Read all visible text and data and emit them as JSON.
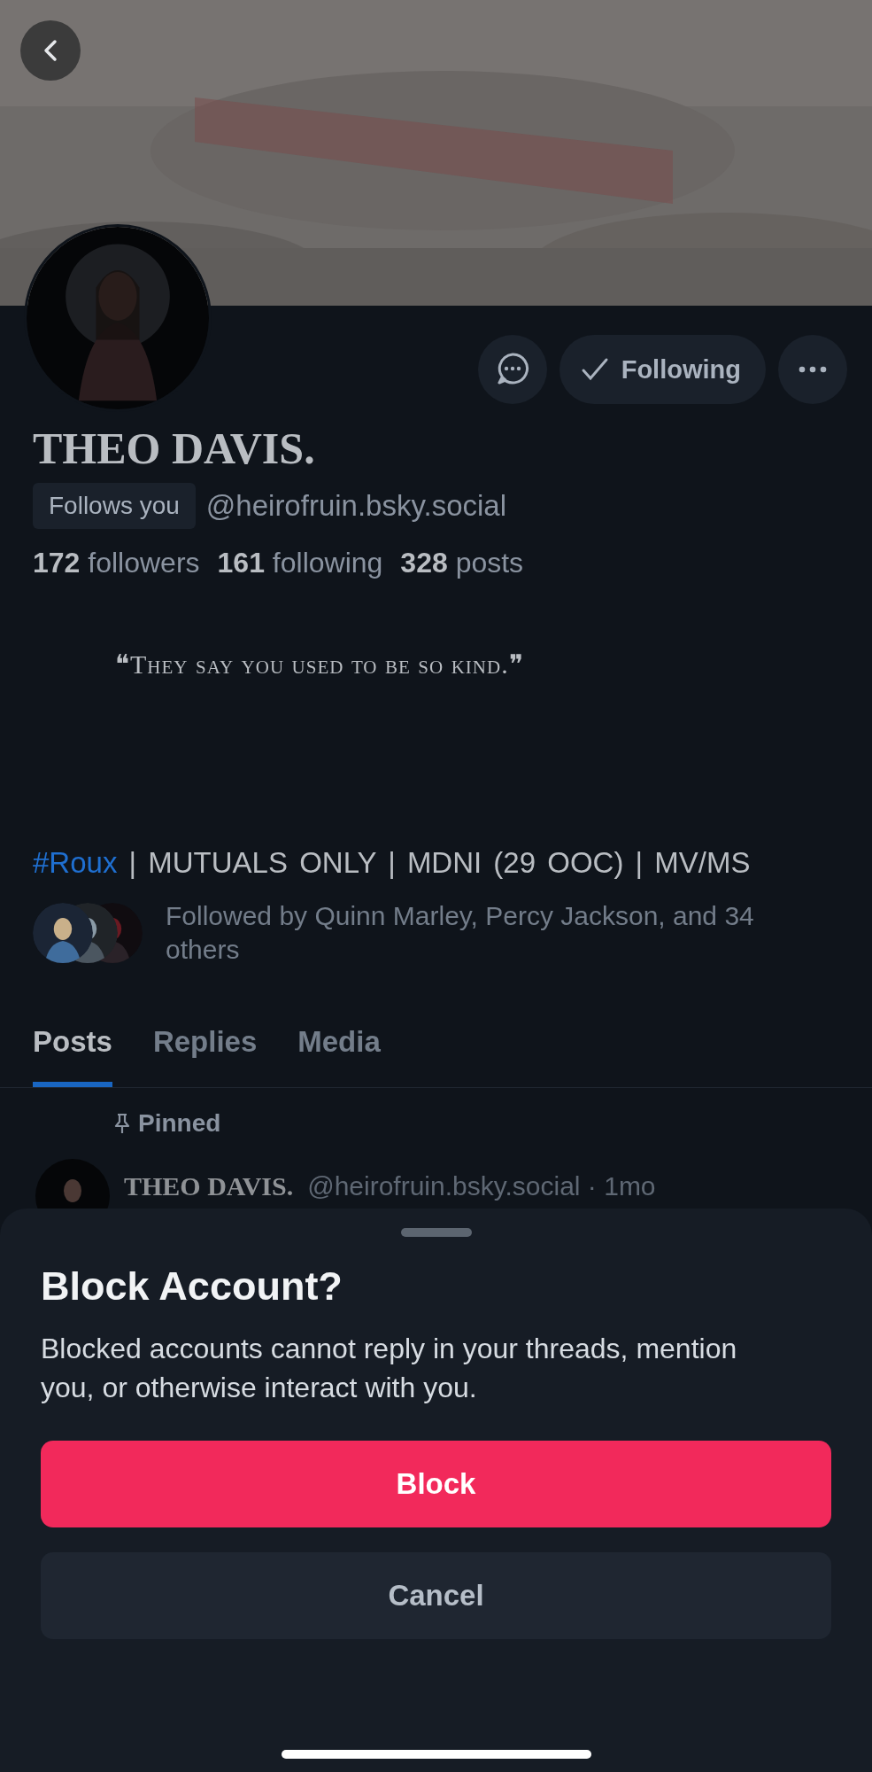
{
  "profile": {
    "name": "THEO DAVIS.",
    "follows_you": "Follows you",
    "handle": "@heirofruin.bsky.social",
    "stats": [
      "**172** followers",
      "**161** following",
      "**328** posts"
    ],
    "quote": "❝They say you used to be so kind.❞",
    "bio_tag": "#Roux",
    "bio_rest": " | MUTUALS ONLY | MDNI (29 OOC) | MV/MS",
    "followed_by": "Followed by Quinn Marley, Percy Jackson, and 34 others",
    "following_button": "Following"
  },
  "tabs": [
    {
      "label": "Posts",
      "selected": true
    },
    {
      "label": "Replies",
      "selected": false
    },
    {
      "label": "Media",
      "selected": false
    }
  ],
  "pinned_post": {
    "pinned": "Pinned",
    "author": "THEO DAVIS.",
    "meta": "@heirofruin.bsky.social · 1mo"
  },
  "sheet": {
    "title": "Block Account?",
    "text": "Blocked accounts cannot reply in your threads, mention you, or otherwise interact with you.",
    "buttons": [
      {
        "label": "Block",
        "kind": "danger"
      },
      {
        "label": "Cancel",
        "kind": "plain"
      }
    ]
  }
}
